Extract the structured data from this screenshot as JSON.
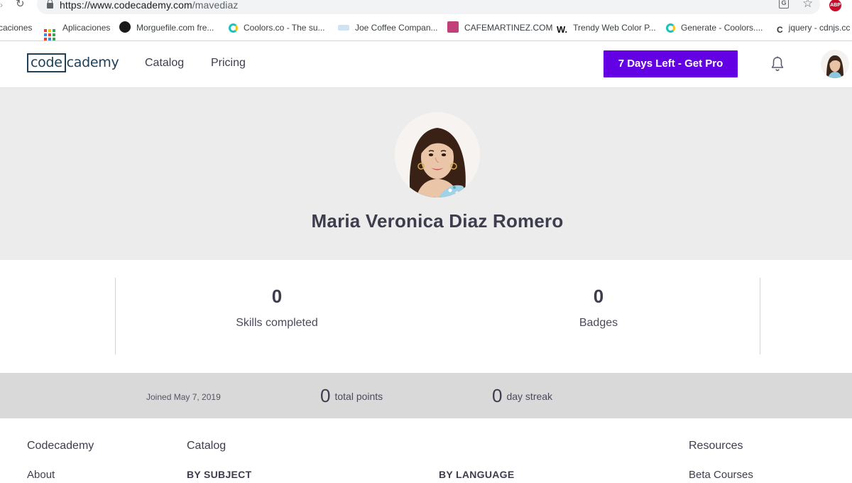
{
  "browser": {
    "url_host": "https://www.codecademy.com",
    "url_path": "/mavediaz",
    "bookmarks": [
      {
        "label": "caciones"
      },
      {
        "label": "Aplicaciones"
      },
      {
        "label": "Morguefile.com fre..."
      },
      {
        "label": "Coolors.co - The su..."
      },
      {
        "label": "Joe Coffee Compan..."
      },
      {
        "label": "CAFEMARTINEZ.COM"
      },
      {
        "label": "Trendy Web Color P..."
      },
      {
        "label": "Generate - Coolors...."
      },
      {
        "label": "jquery - cdnjs.cc"
      }
    ],
    "adblock_label": "ABP"
  },
  "header": {
    "logo_code": "code",
    "logo_rest": "cademy",
    "nav": {
      "catalog": "Catalog",
      "pricing": "Pricing"
    },
    "pro_button": "7 Days Left - Get Pro"
  },
  "profile": {
    "name": "Maria Veronica Diaz Romero"
  },
  "stats": {
    "skills": {
      "value": "0",
      "label": "Skills completed"
    },
    "badges": {
      "value": "0",
      "label": "Badges"
    }
  },
  "summary": {
    "joined": "Joined May 7, 2019",
    "points": {
      "value": "0",
      "label": "total points"
    },
    "streak": {
      "value": "0",
      "label": "day streak"
    }
  },
  "footer": {
    "col1": {
      "heading": "Codecademy",
      "link": "About"
    },
    "col2": {
      "heading": "Catalog",
      "by_subject": "BY SUBJECT",
      "by_language": "BY LANGUAGE"
    },
    "col3": {
      "heading": "Resources",
      "link": "Beta Courses"
    }
  },
  "colors": {
    "brand_purple": "#6400e4",
    "logo_navy": "#1f4056",
    "hero_bg": "#ececec",
    "summary_bg": "#d9d9d9"
  },
  "icons": [
    "reload-icon",
    "lock-icon",
    "translate-icon",
    "star-icon",
    "adblock-icon",
    "apps-icon",
    "bell-icon"
  ]
}
